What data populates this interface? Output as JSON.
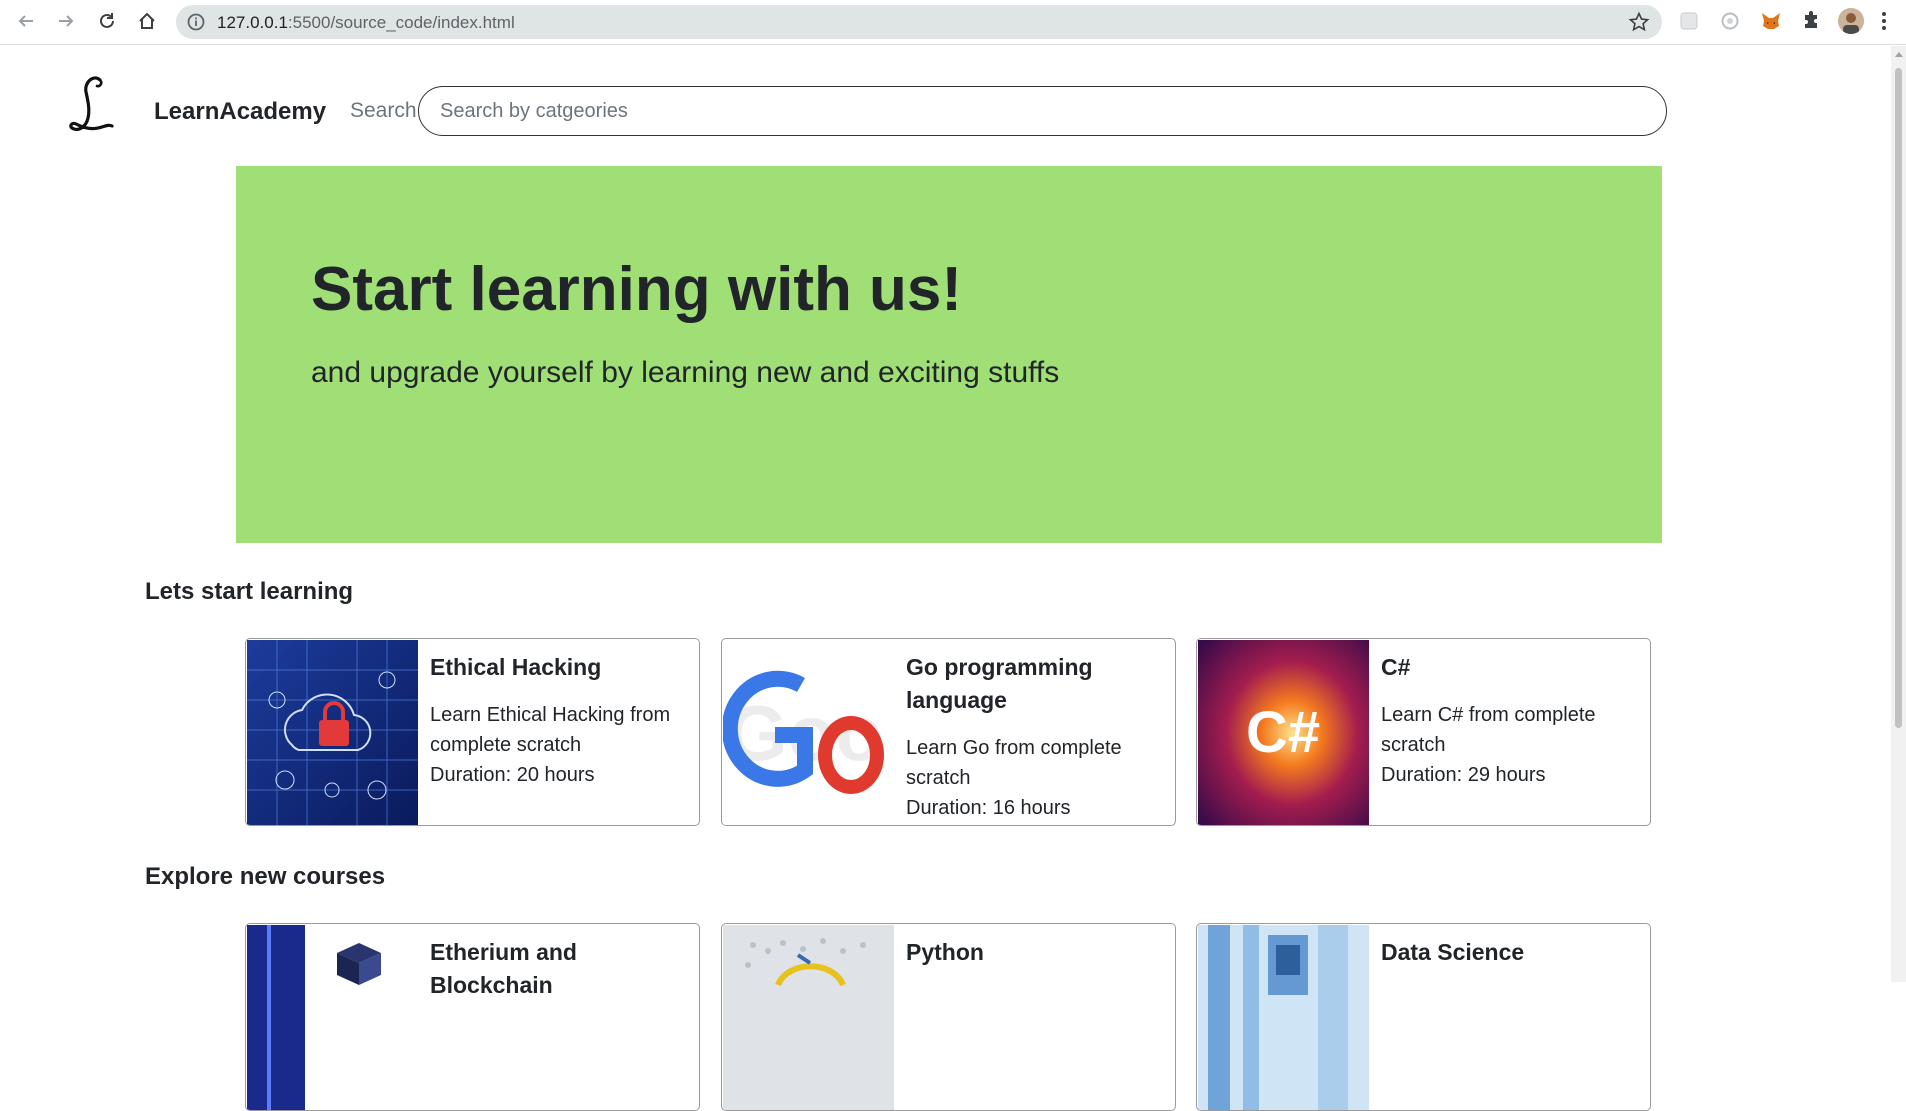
{
  "browser": {
    "url_host": "127.0.0.1",
    "url_rest": ":5500/source_code/index.html"
  },
  "navbar": {
    "brand": "LearnAcademy",
    "search_label": "Search",
    "search_placeholder": "Search by catgeories"
  },
  "hero": {
    "title": "Start learning with us!",
    "subtitle": "and upgrade yourself by learning new and exciting stuffs",
    "color": "#9fdf76"
  },
  "sections": [
    {
      "title": "Lets start learning",
      "courses": [
        {
          "title": "Ethical Hacking",
          "description": "Learn Ethical Hacking from complete scratch",
          "duration": "Duration: 20 hours"
        },
        {
          "title": "Go programming language",
          "description": "Learn Go from complete scratch",
          "duration": "Duration: 16 hours"
        },
        {
          "title": "C#",
          "description": "Learn C# from complete scratch",
          "duration": "Duration: 29 hours"
        }
      ]
    },
    {
      "title": "Explore new courses",
      "courses": [
        {
          "title": "Etherium and Blockchain"
        },
        {
          "title": "Python"
        },
        {
          "title": "Data Science"
        }
      ]
    }
  ]
}
